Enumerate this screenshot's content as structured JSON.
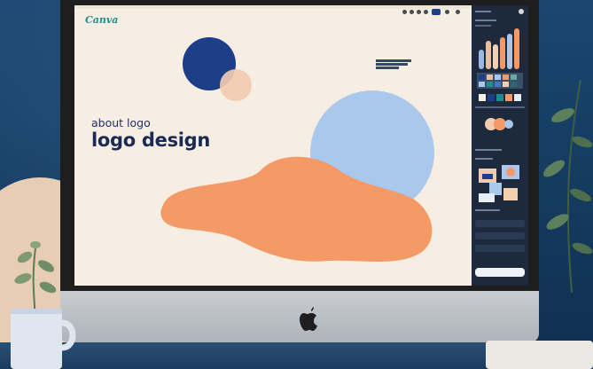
{
  "app": {
    "brand": "Canva"
  },
  "canvas": {
    "about_text": "about logo",
    "title": "logo design"
  },
  "colors": {
    "navy": "#1d3e88",
    "peach": "#f1cbb0",
    "sky_blue": "#a9c8ec",
    "orange": "#f39a66",
    "cream": "#f6eee2",
    "sidebar": "#1d2a3e",
    "brand_teal": "#1f8e8a"
  },
  "icons": [
    "apple-logo-icon",
    "plant-icon",
    "mug-icon"
  ]
}
